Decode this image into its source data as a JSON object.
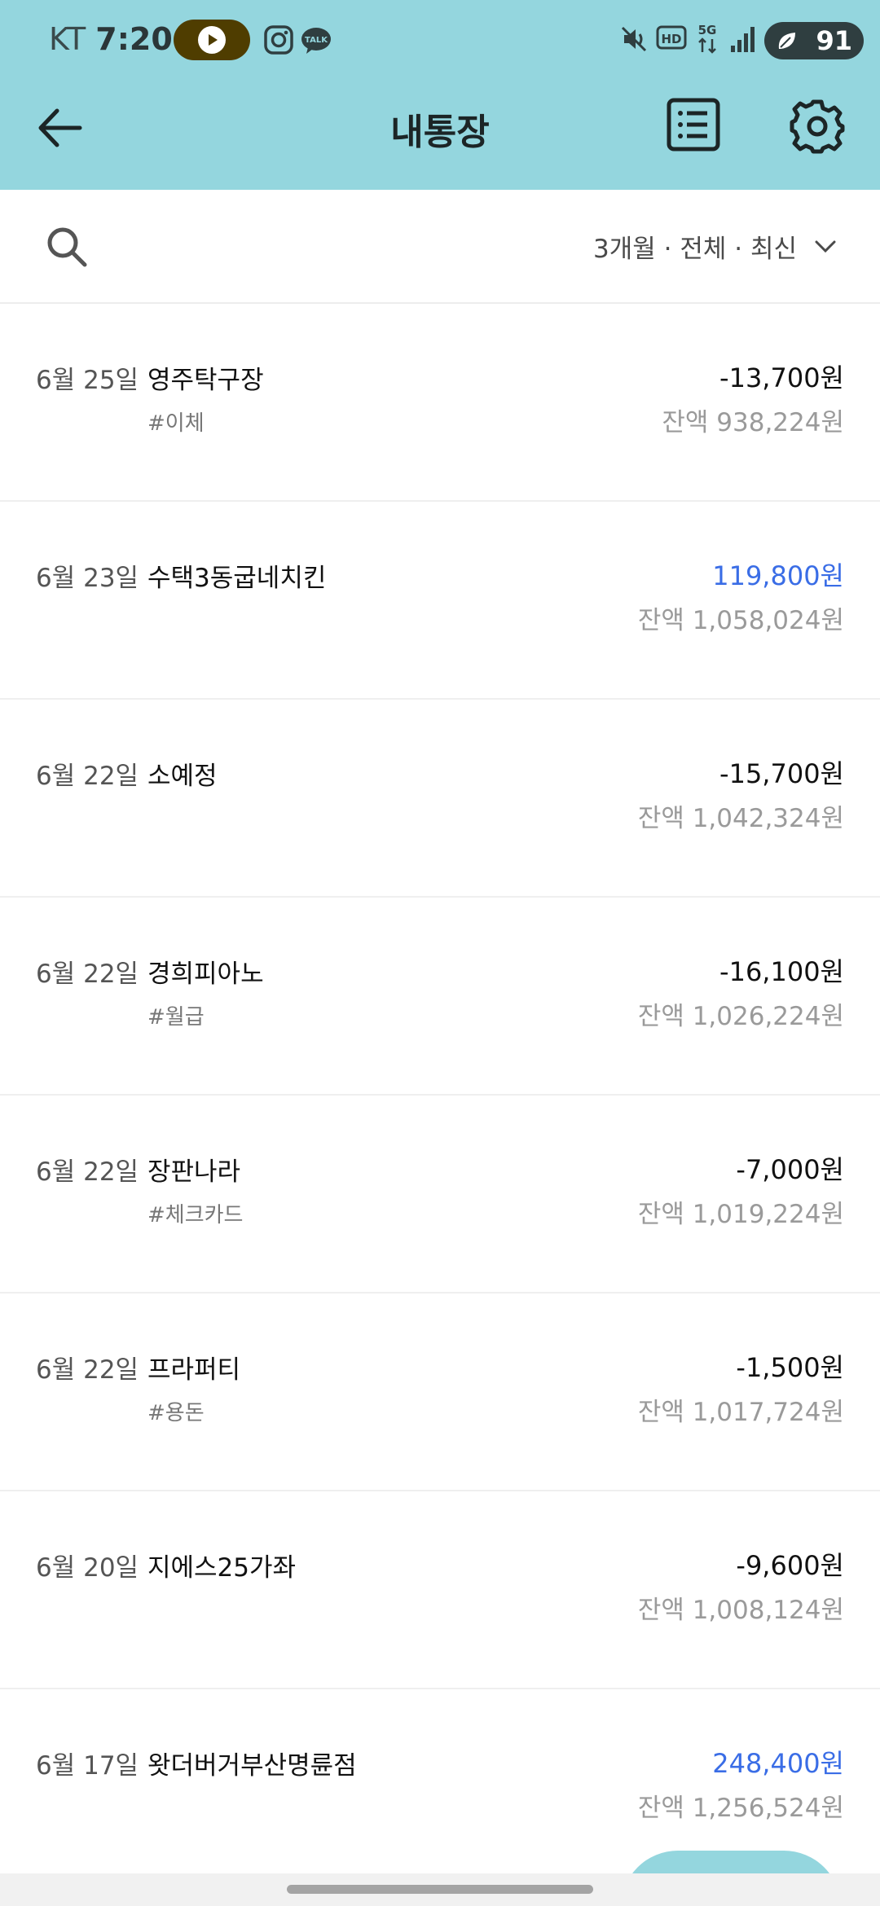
{
  "status_bar": {
    "carrier": "KT",
    "time": "7:20",
    "battery": "91",
    "icons": [
      "youtube-music-icon",
      "instagram-icon",
      "kakaotalk-icon",
      "mute-icon",
      "hd-icon",
      "5g-icon",
      "signal-icon",
      "battery-icon"
    ],
    "kakao_label": "TALK",
    "hd_label": "HD",
    "fiveg_label": "5G"
  },
  "header": {
    "title": "내통장",
    "background": "#94d6de"
  },
  "filter": {
    "label": "3개월 · 전체 · 최신"
  },
  "colors": {
    "deposit": "#3a6de6",
    "withdrawal": "#111111",
    "balance": "#9a9a9a"
  },
  "transactions": [
    {
      "date": "6월 25일",
      "name": "영주탁구장",
      "tag": "#이체",
      "amount": "-13,700원",
      "balance": "잔액 938,224원",
      "type": "withdrawal"
    },
    {
      "date": "6월 23일",
      "name": "수택3동굽네치킨",
      "tag": "",
      "amount": "119,800원",
      "balance": "잔액 1,058,024원",
      "type": "deposit"
    },
    {
      "date": "6월 22일",
      "name": "소예정",
      "tag": "",
      "amount": "-15,700원",
      "balance": "잔액 1,042,324원",
      "type": "withdrawal"
    },
    {
      "date": "6월 22일",
      "name": "경희피아노",
      "tag": "#월급",
      "amount": "-16,100원",
      "balance": "잔액 1,026,224원",
      "type": "withdrawal"
    },
    {
      "date": "6월 22일",
      "name": "장판나라",
      "tag": "#체크카드",
      "amount": "-7,000원",
      "balance": "잔액 1,019,224원",
      "type": "withdrawal"
    },
    {
      "date": "6월 22일",
      "name": "프라퍼티",
      "tag": "#용돈",
      "amount": "-1,500원",
      "balance": "잔액 1,017,724원",
      "type": "withdrawal"
    },
    {
      "date": "6월 20일",
      "name": "지에스25가좌",
      "tag": "",
      "amount": "-9,600원",
      "balance": "잔액 1,008,124원",
      "type": "withdrawal"
    },
    {
      "date": "6월 17일",
      "name": "왓더버거부산명륜점",
      "tag": "",
      "amount": "248,400원",
      "balance": "잔액 1,256,524원",
      "type": "deposit"
    }
  ]
}
